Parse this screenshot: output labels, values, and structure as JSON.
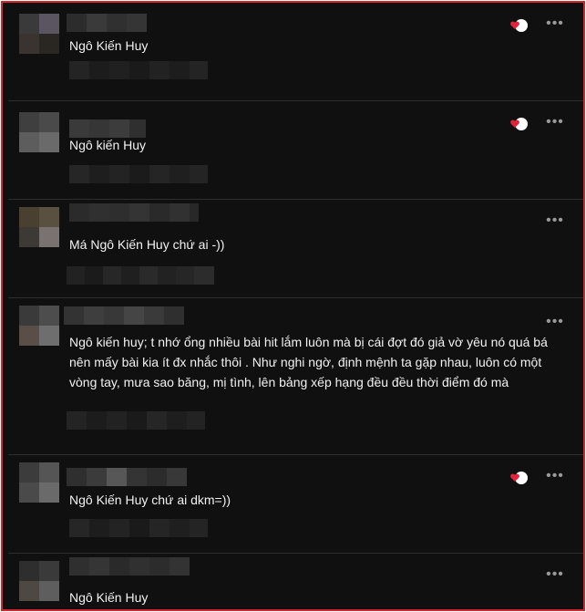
{
  "comments": [
    {
      "text": "Ngô Kiến Huy",
      "has_reaction": true
    },
    {
      "text": "Ngô kiến Huy",
      "has_reaction": true
    },
    {
      "text": "Má Ngô Kiến Huy chứ ai -))",
      "has_reaction": false
    },
    {
      "text": "Ngô kiến huy; t nhớ ổng nhiều bài hit lắm luôn mà bị cái đợt đó giả vờ yêu nó quá bá nên mấy bài kia ít đx nhắc thôi . Như nghi ngờ, định mệnh ta gặp nhau, luôn có một vòng tay, mưa sao băng, mị tình, lên bảng xếp hạng đều đều thời điểm đó mà",
      "has_reaction": false
    },
    {
      "text": "Ngô Kiến Huy chứ ai dkm=))",
      "has_reaction": true
    },
    {
      "text": "Ngô Kiến Huy",
      "has_reaction": false
    }
  ],
  "icons": {
    "reaction": "heart-reaction-icon",
    "more": "more-options-icon"
  },
  "colors": {
    "background": "#101010",
    "frame_border": "#d4262c",
    "text": "#f2f2f2",
    "heart": "#e0243c"
  }
}
